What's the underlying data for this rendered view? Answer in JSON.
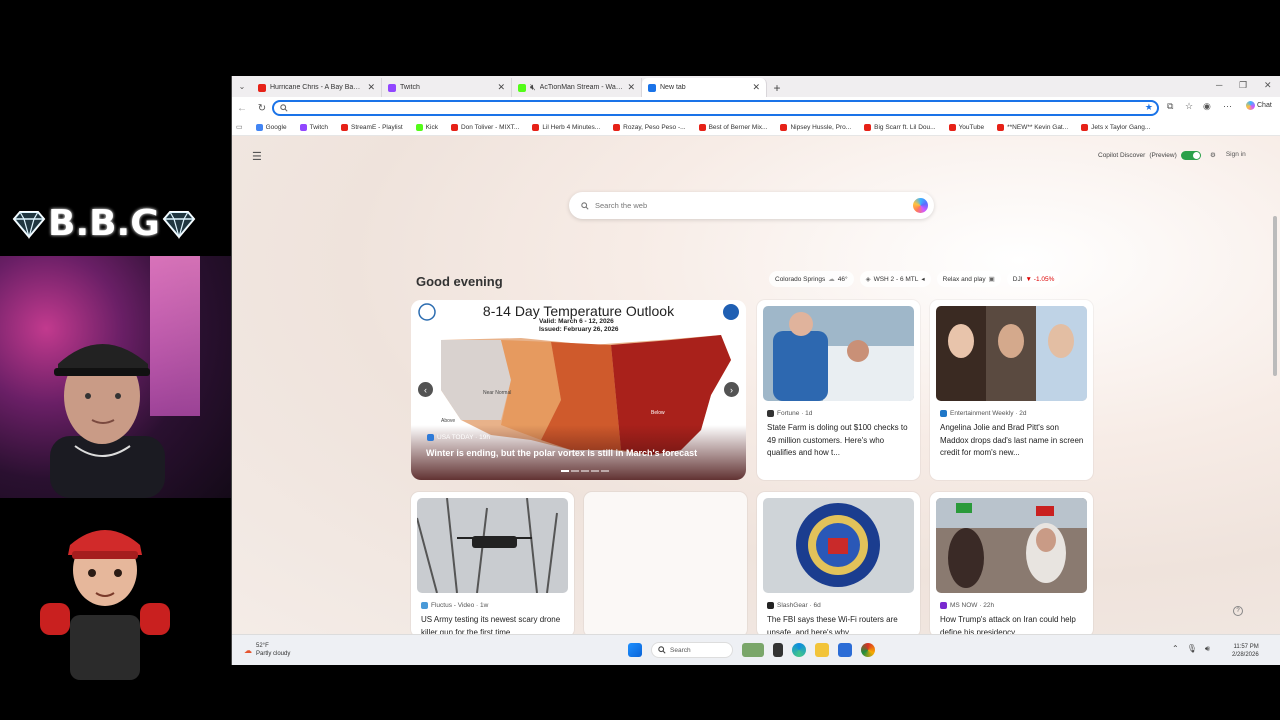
{
  "overlay": {
    "brand_text": "B.B.G"
  },
  "tabs": [
    {
      "label": "Hurricane Chris - A Bay Bay (Offici",
      "favicon_color": "#e62117",
      "close": "✕"
    },
    {
      "label": "Twitch",
      "favicon_color": "#9146ff",
      "close": "✕"
    },
    {
      "label": "AcTionMan Stream - Watch L",
      "favicon_color": "#53fc18",
      "close": "✕"
    },
    {
      "label": "New tab",
      "favicon_color": "#1a73e8",
      "close": "✕"
    }
  ],
  "toolbar": {
    "address_value": "",
    "chat_label": "Chat"
  },
  "bookmarks": [
    {
      "label": "Google",
      "color": "#4285f4"
    },
    {
      "label": "Twitch",
      "color": "#9146ff"
    },
    {
      "label": "StreamE - Playlist",
      "color": "#e62117"
    },
    {
      "label": "Kick",
      "color": "#53fc18"
    },
    {
      "label": "Don Toliver - MIXT...",
      "color": "#e62117"
    },
    {
      "label": "Lil Herb 4 Minutes...",
      "color": "#e62117"
    },
    {
      "label": "Rozay, Peso Peso -...",
      "color": "#e62117"
    },
    {
      "label": "Best of Berner Mix...",
      "color": "#e62117"
    },
    {
      "label": "Nipsey Hussle, Pro...",
      "color": "#e62117"
    },
    {
      "label": "Big Scarr ft. Lil Dou...",
      "color": "#e62117"
    },
    {
      "label": "YouTube",
      "color": "#e62117"
    },
    {
      "label": "**NEW** Kevin Gat...",
      "color": "#e62117"
    },
    {
      "label": "Jets x Taylor Gang...",
      "color": "#e62117"
    }
  ],
  "page": {
    "copilot_discover": "Copilot Discover",
    "preview": "(Preview)",
    "signin": "Sign in",
    "search_placeholder": "Search the web",
    "greeting": "Good evening",
    "chips": [
      {
        "label": "Colorado Springs",
        "extra": "46°"
      },
      {
        "label": "WSH 2 - 6 MTL",
        "extra": ""
      },
      {
        "label": "Relax and play",
        "extra": ""
      },
      {
        "label": "DJI",
        "extra": "▼ -1.05%"
      }
    ]
  },
  "hero": {
    "map_title": "8-14 Day Temperature Outlook",
    "valid": "Valid:  March 6 - 12, 2026",
    "issued": "Issued:  February 26, 2026",
    "map_labels": [
      "Above",
      "Below",
      "Near Normal"
    ],
    "source": "USA TODAY · 19h",
    "headline": "Winter is ending, but the polar vortex is still in March's forecast"
  },
  "cards": [
    {
      "source": "Fortune · 1d",
      "title": "State Farm is doling out $100 checks to 49 million customers. Here's who qualifies and how t..."
    },
    {
      "source": "Entertainment Weekly · 2d",
      "title": "Angelina Jolie and Brad Pitt's son Maddox drops dad's last name in screen credit for mom's new..."
    },
    {
      "source": "Fluctus - Video · 1w",
      "title": "US Army testing its newest scary drone killer gun for the first time"
    },
    {
      "source": "SlashGear · 6d",
      "title": "The FBI says these Wi-Fi routers are unsafe, and here's why"
    },
    {
      "source": "MS NOW · 22h",
      "title": "How Trump's attack on Iran could help define his presidency"
    }
  ],
  "taskbar": {
    "temp": "52°F",
    "weather": "Partly cloudy",
    "search_label": "Search",
    "time": "11:57 PM",
    "date": "2/28/2026"
  }
}
